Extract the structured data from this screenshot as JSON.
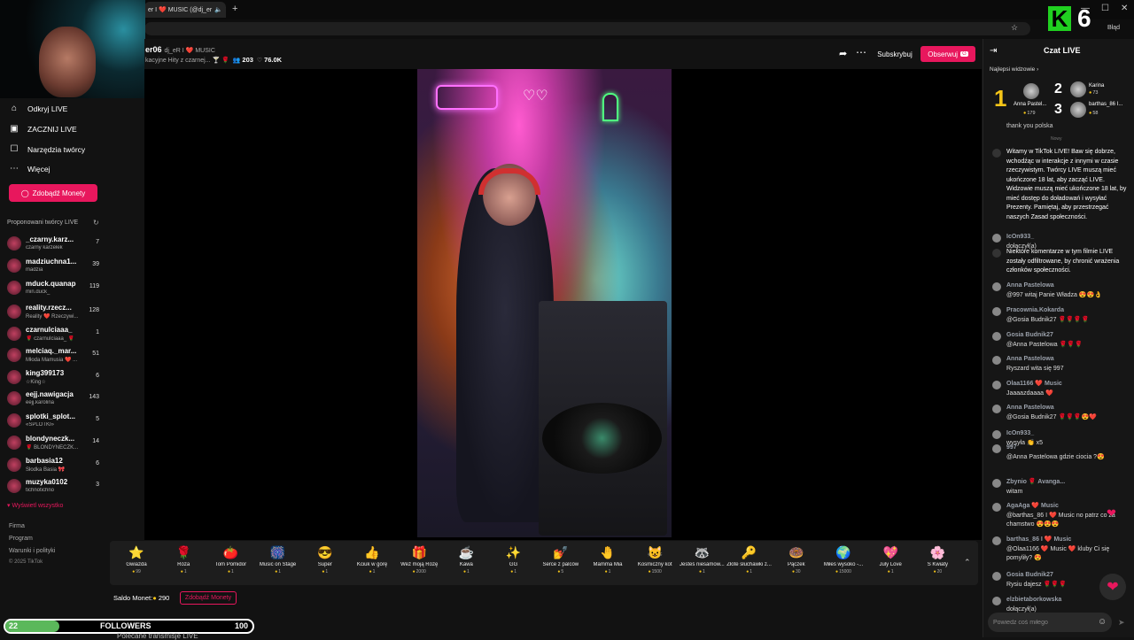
{
  "browser": {
    "tab_title": "er I ❤️ MUSIC (@dj_er",
    "window_controls": [
      "—",
      "☐",
      "✕"
    ],
    "profile_label": "Błąd",
    "overlay_k": "K",
    "overlay_number": "6"
  },
  "sidebar": {
    "items": [
      {
        "label": "Odkryj LIVE",
        "icon": "home-icon"
      },
      {
        "label": "ZACZNIJ LIVE",
        "icon": "live-icon"
      },
      {
        "label": "Narzędzia twórcy",
        "icon": "tools-icon"
      },
      {
        "label": "Więcej",
        "icon": "more-icon"
      }
    ],
    "coins_button": "Zdobądź Monety",
    "suggested_title": "Proponowani twórcy LIVE",
    "creators": [
      {
        "name": "_czarny.karz...",
        "sub": "czarny karzełek",
        "count": "7"
      },
      {
        "name": "madziuchna1...",
        "sub": "madzia",
        "count": "39"
      },
      {
        "name": "mduck.quanap",
        "sub": "min.duck_",
        "count": "119"
      },
      {
        "name": "reality.rzecz...",
        "sub": "Reality ❤️ Rzeczywi...",
        "count": "128"
      },
      {
        "name": "czarnulciaaa_",
        "sub": "🌹 czarnulciaaa_ 🌹",
        "count": "1"
      },
      {
        "name": "melciaq._mar...",
        "sub": "Młoda Mamusia ❤️ ...",
        "count": "51"
      },
      {
        "name": "king399173",
        "sub": "☆King☆",
        "count": "6"
      },
      {
        "name": "eejj.nawigacja",
        "sub": "eejj.karolina",
        "count": "143"
      },
      {
        "name": "splotki_splot...",
        "sub": "«SPLOTKI»",
        "count": "5"
      },
      {
        "name": "blondyneczk...",
        "sub": "🌹 BLONDYNECZK...",
        "count": "14"
      },
      {
        "name": "barbasia12",
        "sub": "Słodka Basia 🎀",
        "count": "6"
      },
      {
        "name": "muzyka0102",
        "sub": "tichnotichno",
        "count": "3"
      }
    ],
    "show_all": "Wyświetl wszystko",
    "footer": [
      "Firma",
      "Program",
      "Warunki i polityki",
      "© 2025 TikTok"
    ]
  },
  "stream": {
    "name": "er06",
    "handle": "dj_eR I ❤️ MUSIC",
    "subtitle": "kacyjne Hity z czarnej... 🍸 🌹",
    "viewers": "203",
    "likes": "76.0K",
    "subscribe": "Subskrybuj",
    "follow": "Obserwuj",
    "follow_badge": "G"
  },
  "gifts": [
    {
      "icon": "⭐",
      "name": "Gwiazda",
      "price": "99"
    },
    {
      "icon": "🌹",
      "name": "Róża",
      "price": "1"
    },
    {
      "icon": "🍅",
      "name": "Tom Pomidor",
      "price": "1"
    },
    {
      "icon": "🎆",
      "name": "Music on Stage",
      "price": "1"
    },
    {
      "icon": "😎",
      "name": "Super",
      "price": "1"
    },
    {
      "icon": "👍",
      "name": "Kciuk w górę",
      "price": "1"
    },
    {
      "icon": "🎁",
      "name": "Weź moją Różę",
      "price": "2000"
    },
    {
      "icon": "☕",
      "name": "Kawa",
      "price": "1"
    },
    {
      "icon": "✨",
      "name": "GG",
      "price": "1"
    },
    {
      "icon": "💅",
      "name": "Serce z palców",
      "price": "5"
    },
    {
      "icon": "🤚",
      "name": "Mamma Mia",
      "price": "1"
    },
    {
      "icon": "😺",
      "name": "Kosmiczny kot",
      "price": "1500"
    },
    {
      "icon": "🦝",
      "name": "Jesteś niesamow...",
      "price": "1"
    },
    {
      "icon": "🔑",
      "name": "Złote słuchawki z...",
      "price": "1"
    },
    {
      "icon": "🍩",
      "name": "Pączek",
      "price": "30"
    },
    {
      "icon": "🌍",
      "name": "Miłeś wysoko -...",
      "price": "15000"
    },
    {
      "icon": "💖",
      "name": "July Love",
      "price": "1"
    },
    {
      "icon": "🌸",
      "name": "S Kwiaty",
      "price": "20"
    }
  ],
  "balance": {
    "label": "Saldo Monet:",
    "value": "290",
    "buy": "Zdobądź Monety"
  },
  "followers_goal": {
    "current": "22",
    "label": "FOLLOWERS",
    "goal": "100",
    "progress": 0.22,
    "below": "Polecane transmisje LIVE"
  },
  "chat": {
    "title": "Czat LIVE",
    "top_title": "Najlepsi widzowie",
    "top": [
      {
        "rank": "1",
        "name": "Anna Pastel...",
        "coins": "179"
      },
      {
        "rank": "2",
        "name": "Karina",
        "coins": "73"
      },
      {
        "rank": "3",
        "name": "barthas_86 I...",
        "coins": "58"
      }
    ],
    "cut_text": "thank you polska",
    "new_label": "Nowy",
    "messages": [
      {
        "name": "",
        "text": "Witamy w TikTok LIVE! Baw się dobrze, wchodźąc w interakcje z innymi w czasie rzeczywistym. Twórcy LIVE muszą mieć ukończone 18 lat, aby zacząć LIVE. Widzowie muszą mieć ukończone 18 lat, by mieć dostęp do doładowań i wysyłać Prezenty. Pamiętaj, aby przestrzegać naszych Zasad społeczności."
      },
      {
        "name": "IcOn933_",
        "text": "dołączył(a)"
      },
      {
        "name": "",
        "text": "Niektóre komentarze w tym filmie LIVE zostały odfiltrowane, by chronić wrażenia członków społeczności."
      },
      {
        "name": "Anna Pastelowa",
        "text": "@997 witaj Panie Władza 😍😍👌"
      },
      {
        "name": "Pracownia.Kokarda",
        "text": "@Gosia Budnik27 🌹🌹🌹🌹"
      },
      {
        "name": "Gosia Budnik27",
        "text": "@Anna Pastelowa 🌹🌹🌹"
      },
      {
        "name": "Anna Pastelowa",
        "text": "Ryszard wita się 997"
      },
      {
        "name": "Olaa1166 ❤️ Music",
        "text": "Jaaaazdaaaa ❤️"
      },
      {
        "name": "Anna Pastelowa",
        "text": "@Gosia Budnik27 🌹🌹🌹😍❤️"
      },
      {
        "name": "IcOn933_",
        "text": "wysyła 👏 x5"
      },
      {
        "name": "997",
        "text": "@Anna Pastelowa gdzie ciocia ?😍"
      },
      {
        "name": "Zbynio 🌹 Avanga...",
        "text": "witam"
      },
      {
        "name": "AgaAga ❤️ Music",
        "text": "@barthas_86 I ❤️ Music no patrz co za chamstwo 😍😍😍"
      },
      {
        "name": "barthas_86 I ❤️ Music",
        "text": "@Olaa1166 ❤️ Music ❤️ kluby Ci się pomyliły? 😍"
      },
      {
        "name": "Gosia Budnik27",
        "text": "Rysiu dajesz 🌹🌹🌹"
      },
      {
        "name": "elzbietaborkowska",
        "text": "dołączył(a)"
      }
    ],
    "input_placeholder": "Powiedz coś miłego"
  }
}
